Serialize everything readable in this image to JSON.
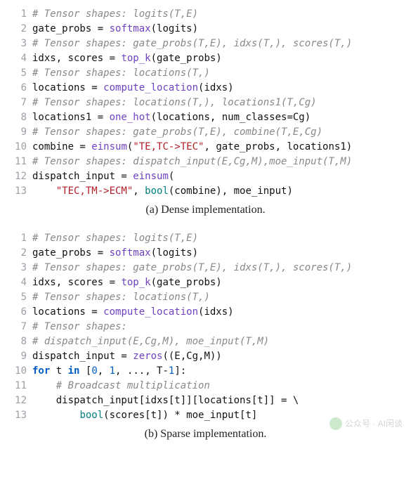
{
  "block_a": {
    "caption": "(a) Dense implementation.",
    "lines": [
      {
        "n": "1",
        "cls": "comment",
        "text": "# Tensor shapes: logits(T,E)"
      },
      {
        "n": "2",
        "cls": "code",
        "tokens": [
          "gate_probs",
          " = ",
          [
            "func",
            "softmax"
          ],
          "(logits)"
        ]
      },
      {
        "n": "3",
        "cls": "comment",
        "text": "# Tensor shapes: gate_probs(T,E), idxs(T,), scores(T,)"
      },
      {
        "n": "4",
        "cls": "code",
        "tokens": [
          "idxs, scores = ",
          [
            "func",
            "top_k"
          ],
          "(gate_probs)"
        ]
      },
      {
        "n": "5",
        "cls": "comment",
        "text": "# Tensor shapes: locations(T,)"
      },
      {
        "n": "6",
        "cls": "code",
        "tokens": [
          "locations = ",
          [
            "func",
            "compute_location"
          ],
          "(idxs)"
        ]
      },
      {
        "n": "7",
        "cls": "comment",
        "text": "# Tensor shapes: locations(T,), locations1(T,Cg)"
      },
      {
        "n": "8",
        "cls": "code",
        "tokens": [
          "locations1 = ",
          [
            "func",
            "one_hot"
          ],
          "(locations, num_classes=Cg)"
        ]
      },
      {
        "n": "9",
        "cls": "comment",
        "text": "# Tensor shapes: gate_probs(T,E), combine(T,E,Cg)"
      },
      {
        "n": "10",
        "cls": "code",
        "tokens": [
          "combine = ",
          [
            "func",
            "einsum"
          ],
          "(",
          [
            "str",
            "\"TE,TC->TEC\""
          ],
          ", gate_probs, locations1)"
        ]
      },
      {
        "n": "11",
        "cls": "comment",
        "text": "# Tensor shapes: dispatch_input(E,Cg,M),moe_input(T,M)"
      },
      {
        "n": "12",
        "cls": "code",
        "tokens": [
          "dispatch_input = ",
          [
            "func",
            "einsum"
          ],
          "("
        ]
      },
      {
        "n": "13",
        "cls": "code",
        "tokens": [
          "    ",
          [
            "str",
            "\"TEC,TM->ECM\""
          ],
          ", ",
          [
            "builtin",
            "bool"
          ],
          "(combine), moe_input)"
        ]
      }
    ]
  },
  "block_b": {
    "caption": "(b) Sparse implementation.",
    "lines": [
      {
        "n": "1",
        "cls": "comment",
        "text": "# Tensor shapes: logits(T,E)"
      },
      {
        "n": "2",
        "cls": "code",
        "tokens": [
          "gate_probs = ",
          [
            "func",
            "softmax"
          ],
          "(logits)"
        ]
      },
      {
        "n": "3",
        "cls": "comment",
        "text": "# Tensor shapes: gate_probs(T,E), idxs(T,), scores(T,)"
      },
      {
        "n": "4",
        "cls": "code",
        "tokens": [
          "idxs, scores = ",
          [
            "func",
            "top_k"
          ],
          "(gate_probs)"
        ]
      },
      {
        "n": "5",
        "cls": "comment",
        "text": "# Tensor shapes: locations(T,)"
      },
      {
        "n": "6",
        "cls": "code",
        "tokens": [
          "locations = ",
          [
            "func",
            "compute_location"
          ],
          "(idxs)"
        ]
      },
      {
        "n": "7",
        "cls": "comment",
        "text": "# Tensor shapes:"
      },
      {
        "n": "8",
        "cls": "comment",
        "text": "# dispatch_input(E,Cg,M), moe_input(T,M)"
      },
      {
        "n": "9",
        "cls": "code",
        "tokens": [
          "dispatch_input = ",
          [
            "func",
            "zeros"
          ],
          "((E,Cg,M))"
        ]
      },
      {
        "n": "10",
        "cls": "code",
        "tokens": [
          [
            "kw",
            "for"
          ],
          " t ",
          [
            "kw",
            "in"
          ],
          " [",
          [
            "num",
            "0"
          ],
          ", ",
          [
            "num",
            "1"
          ],
          ", ..., T-",
          [
            "num",
            "1"
          ],
          "]:"
        ]
      },
      {
        "n": "11",
        "cls": "comment",
        "text": "    # Broadcast multiplication"
      },
      {
        "n": "12",
        "cls": "code",
        "tokens": [
          "    dispatch_input[idxs[t]][locations[t]] = \\"
        ]
      },
      {
        "n": "13",
        "cls": "code",
        "tokens": [
          "        ",
          [
            "builtin",
            "bool"
          ],
          "(scores[t]) * moe_input[t]"
        ]
      }
    ]
  },
  "watermark": {
    "text": "公众号 · AI闲谈"
  }
}
